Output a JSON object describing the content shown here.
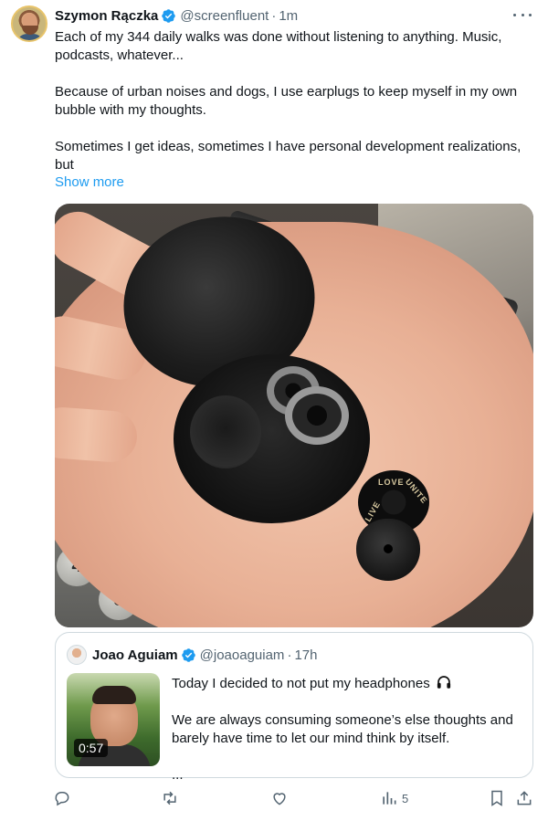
{
  "author": {
    "name": "Szymon Rączka",
    "handle": "@screenfluent",
    "separator": "·",
    "time": "1m"
  },
  "tweet": {
    "paragraphs": [
      "Each of my 344 daily walks was done without listening to anything. Music, podcasts, whatever...",
      "Because of urban noises and dogs, I use earplugs to keep myself in my own bubble with my thoughts.",
      "Sometimes I get ideas, sometimes I have personal development realizations, but"
    ],
    "show_more": "Show more"
  },
  "photo": {
    "keys": [
      "4",
      "5"
    ],
    "earplug_text": [
      "LIVE",
      "LOVE",
      "UNITE"
    ]
  },
  "quoted": {
    "name": "Joao Aguiam",
    "handle": "@joaoaguiam",
    "separator": "·",
    "time": "17h",
    "video_duration": "0:57",
    "paragraph_1": "Today I decided to not put my headphones",
    "paragraph_2": "We are always consuming someone’s else thoughts and barely have time to let our mind think by itself.",
    "ellipsis": "..."
  },
  "actions": {
    "views_count": "5"
  },
  "colors": {
    "accent": "#1d9bf0",
    "muted": "#536471",
    "text": "#0f1419",
    "border": "#cfd9de"
  },
  "icons": [
    "verified-badge-icon",
    "more-icon",
    "headphones-icon",
    "reply-icon",
    "retweet-icon",
    "like-icon",
    "views-icon",
    "bookmark-icon",
    "share-icon"
  ]
}
